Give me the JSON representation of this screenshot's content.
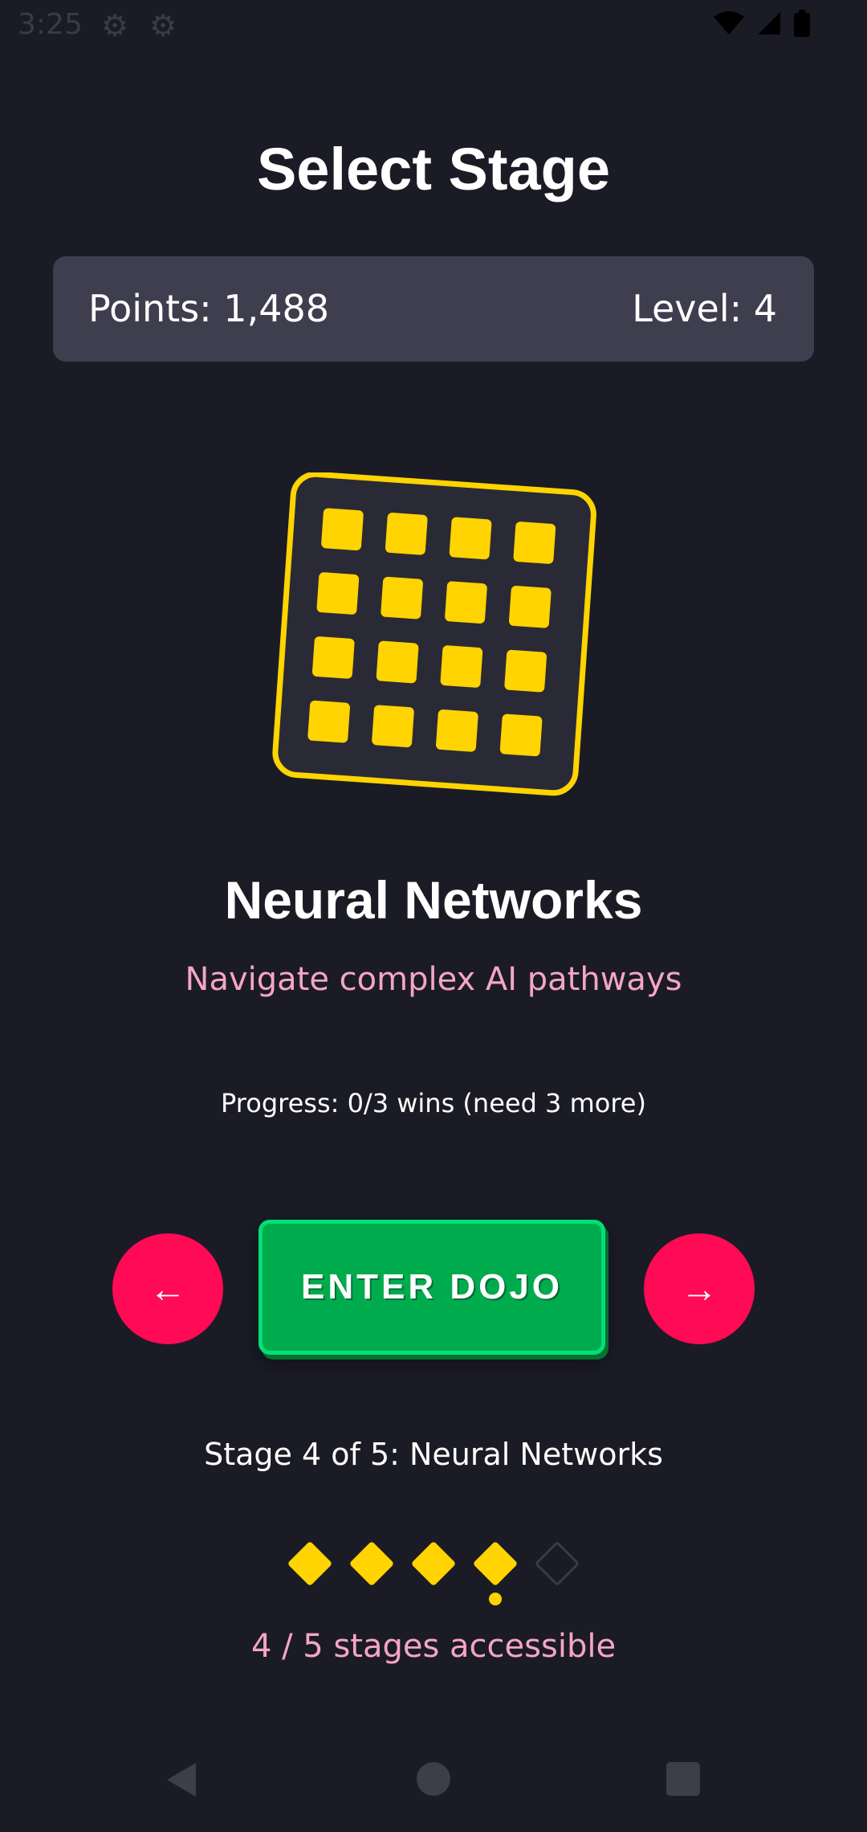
{
  "status_bar": {
    "time": "3:25",
    "icons": [
      "settings-icon",
      "settings-icon",
      "wifi-icon",
      "signal-icon",
      "battery-icon"
    ]
  },
  "header": {
    "title": "Select Stage"
  },
  "stats": {
    "points": "Points: 1,488",
    "level": "Level: 4"
  },
  "stage": {
    "icon": "grid-icon",
    "name": "Neural Networks",
    "description": "Navigate complex AI pathways",
    "progress": "Progress: 0/3 wins (need 3 more)"
  },
  "controls": {
    "prev_label": "←",
    "enter_label": "ENTER DOJO",
    "next_label": "→"
  },
  "stage_indicator": {
    "text": "Stage 4 of 5: Neural Networks",
    "total": 5,
    "accessible_count": 4,
    "current": 4,
    "accessible_text": "4 / 5 stages accessible"
  },
  "colors": {
    "background": "#1b1b26",
    "panel": "#3e3e4e",
    "accent_yellow": "#ffd400",
    "accent_pink": "#f4a6c3",
    "nav_button": "#ff0a55",
    "enter_button": "#00ab4e"
  },
  "system_nav": [
    "back-icon",
    "home-icon",
    "recents-icon"
  ]
}
